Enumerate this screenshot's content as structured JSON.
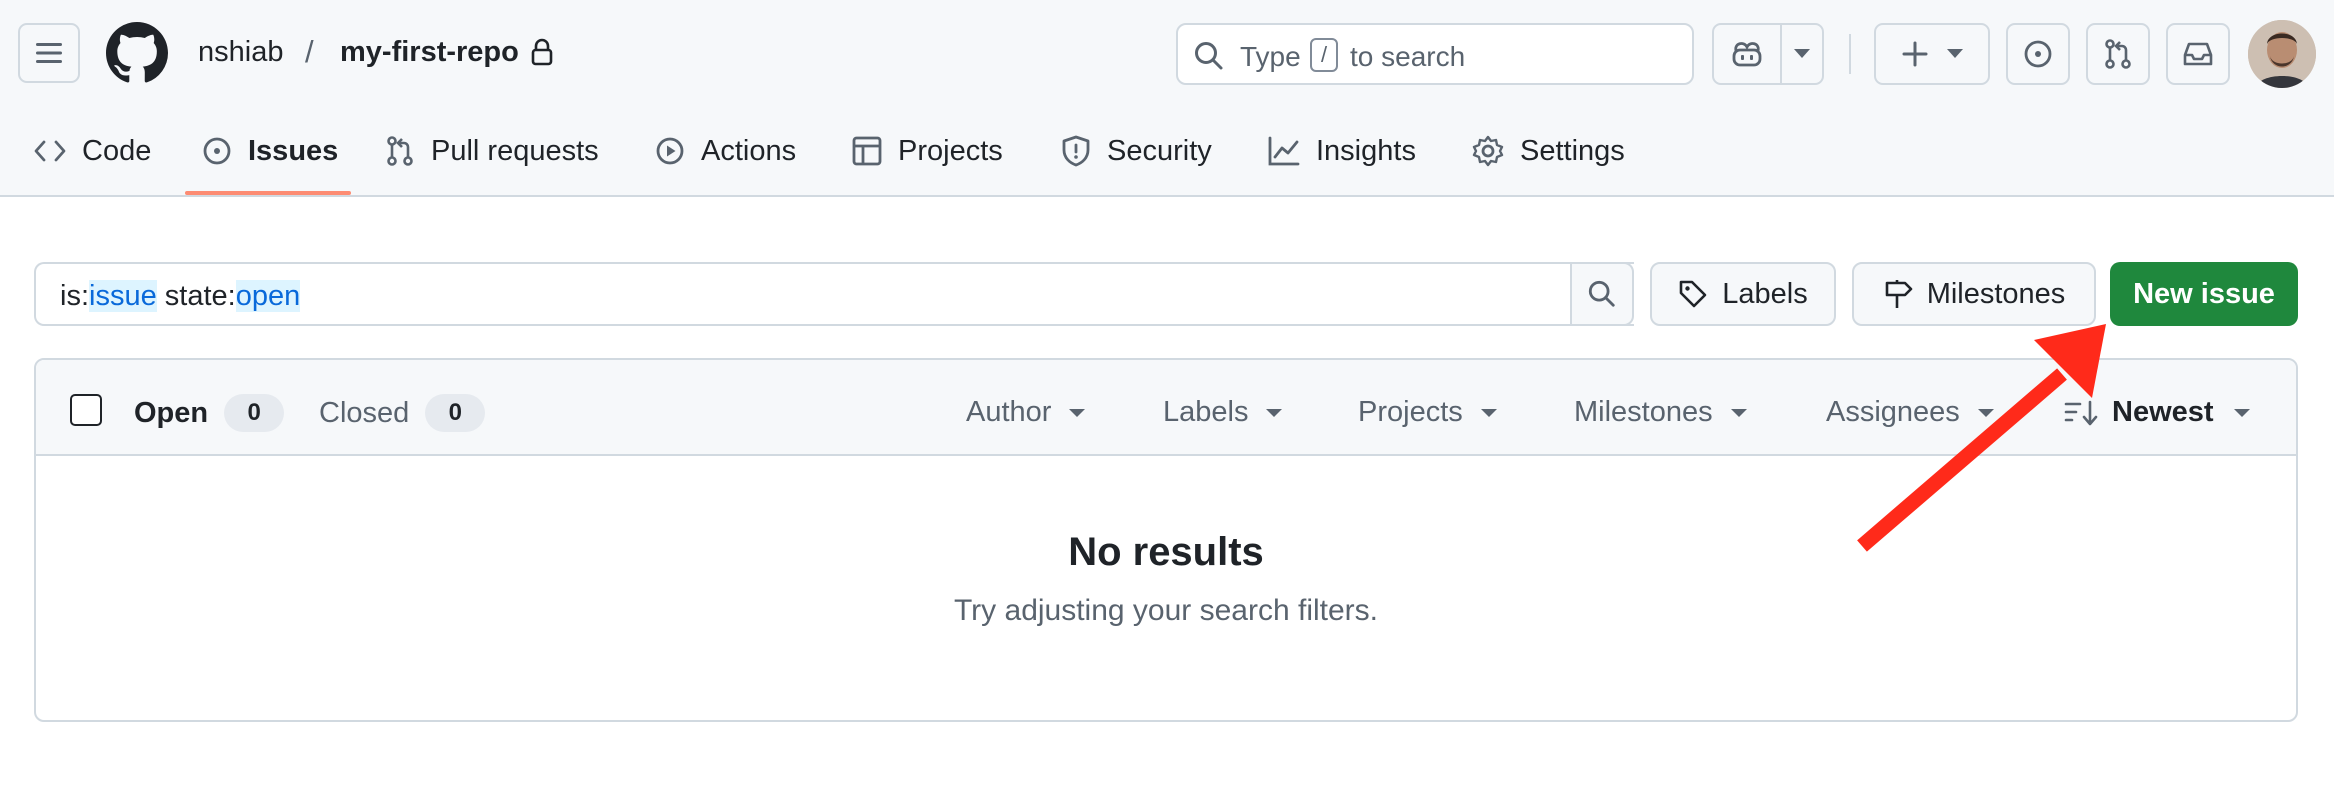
{
  "header": {
    "owner": "nshiab",
    "separator": "/",
    "repo": "my-first-repo",
    "search": {
      "prefix": "Type",
      "key": "/",
      "suffix": "to search"
    }
  },
  "nav": {
    "tabs": [
      {
        "label": "Code",
        "icon": "code-icon"
      },
      {
        "label": "Issues",
        "icon": "issue-opened-icon",
        "active": true
      },
      {
        "label": "Pull requests",
        "icon": "git-pull-request-icon"
      },
      {
        "label": "Actions",
        "icon": "play-icon"
      },
      {
        "label": "Projects",
        "icon": "table-icon"
      },
      {
        "label": "Security",
        "icon": "shield-icon"
      },
      {
        "label": "Insights",
        "icon": "graph-icon"
      },
      {
        "label": "Settings",
        "icon": "gear-icon"
      }
    ]
  },
  "filter": {
    "k1": "is:",
    "v1": "issue",
    "k2": " state:",
    "v2": "open"
  },
  "actions": {
    "labels": "Labels",
    "milestones": "Milestones",
    "new_issue": "New issue"
  },
  "list": {
    "open_label": "Open",
    "open_count": "0",
    "closed_label": "Closed",
    "closed_count": "0",
    "filters": [
      "Author",
      "Labels",
      "Projects",
      "Milestones",
      "Assignees"
    ],
    "sort": "Newest",
    "empty_title": "No results",
    "empty_hint": "Try adjusting your search filters."
  },
  "colors": {
    "primary_green": "#1f883d",
    "active_underline": "#fd8c73",
    "annotation_arrow": "#ff2a1a",
    "link_blue": "#0969da"
  }
}
